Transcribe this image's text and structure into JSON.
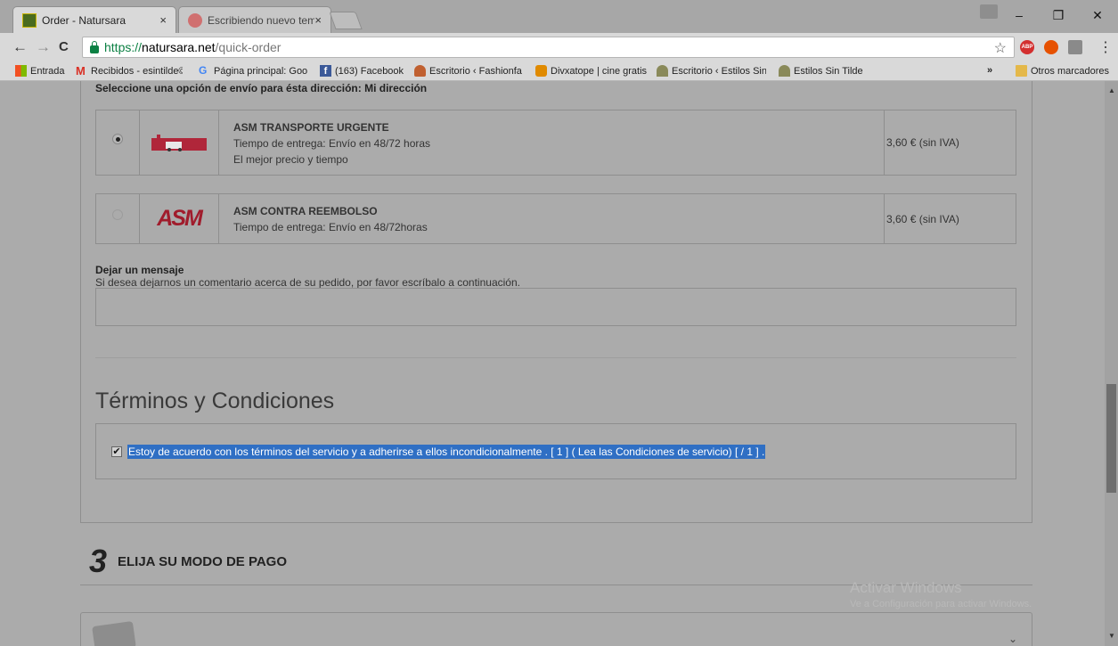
{
  "browser": {
    "tabs": [
      {
        "title": "Order - Natursara",
        "close": "×",
        "active": true
      },
      {
        "title": "Escribiendo nuevo tema",
        "close": "×",
        "active": false
      }
    ],
    "window_controls": {
      "minimize": "–",
      "restore": "❐",
      "close": "✕"
    },
    "nav": {
      "back": "←",
      "forward": "→",
      "reload": "C"
    },
    "url": {
      "scheme": "https://",
      "domain": "natursara.net",
      "path": "/quick-order"
    },
    "star": "☆",
    "extensions": [
      "ABP",
      "fire",
      "puzzle"
    ],
    "menu": "⋮",
    "bookmarks": [
      {
        "label": "Entrada",
        "icon": "windows-icon",
        "color": "#f25022"
      },
      {
        "label": "Recibidos - esintilde©",
        "icon": "gmail-icon",
        "color": "#d93025"
      },
      {
        "label": "Página principal: Goo",
        "icon": "google-icon",
        "color": "#4285f4"
      },
      {
        "label": "(163) Facebook",
        "icon": "facebook-icon",
        "color": "#3b5998"
      },
      {
        "label": "Escritorio ‹ Fashionfa",
        "icon": "user-icon",
        "color": "#c06030"
      },
      {
        "label": "Divxatope | cine gratis",
        "icon": "divx-icon",
        "color": "#e08a00"
      },
      {
        "label": "Escritorio ‹ Estilos Sin",
        "icon": "tree-icon",
        "color": "#8a8a5a"
      },
      {
        "label": "Estilos Sin Tilde",
        "icon": "tree-icon",
        "color": "#8a8a5a"
      }
    ],
    "bookmarks_overflow": "»",
    "other_bookmarks": "Otros marcadores"
  },
  "shipping": {
    "heading": "Seleccione una opción de envío para ésta dirección: Mi dirección",
    "options": [
      {
        "selected": true,
        "name": "ASM TRANSPORTE URGENTE",
        "line1": "Tiempo de entrega: Envío en 48/72 horas",
        "line2": "El mejor precio y tiempo",
        "price": "3,60 € (sin IVA)"
      },
      {
        "selected": false,
        "logo_text": "ASM",
        "name": "ASM CONTRA REEMBOLSO",
        "line1": "Tiempo de entrega: Envío en 48/72horas",
        "price": "3,60 € (sin IVA)"
      }
    ]
  },
  "message": {
    "title": "Dejar un mensaje",
    "description": "Si desea dejarnos un comentario acerca de su pedido, por favor escríbalo a continuación.",
    "value": ""
  },
  "terms": {
    "title": "Términos y Condiciones",
    "checked": true,
    "check_mark": "✔",
    "text": "Estoy de acuerdo con los términos del servicio y a adherirse a ellos incondicionalmente . [ 1 ] ( Lea las Condiciones de servicio) [ / 1 ] ."
  },
  "payment_step": {
    "number": "3",
    "title": "ELIJA SU MODO DE PAGO",
    "chevron": "⌄"
  },
  "watermark": {
    "line1": "Activar Windows",
    "line2": "Ve a Configuración para activar Windows."
  },
  "colors": {
    "overlay_bg": "#ababab",
    "selection": "#2f6fc4",
    "secure_green": "#0b8043"
  }
}
